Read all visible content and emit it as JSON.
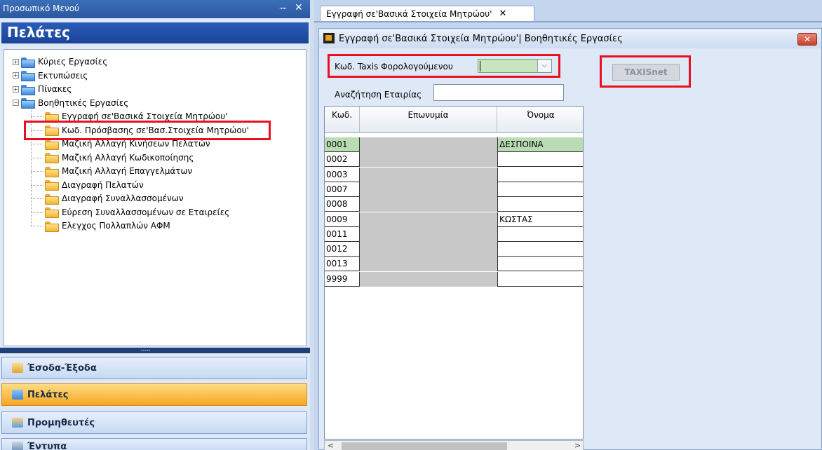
{
  "left_menu": {
    "title": "Προσωπικό Μενού",
    "pin_glyph": "2",
    "close_glyph": "✕",
    "section_title": "Πελάτες",
    "tree": [
      {
        "label": "Κύριες Εργασίες",
        "level": 0,
        "expander": "+"
      },
      {
        "label": "Εκτυπώσεις",
        "level": 0,
        "expander": "+"
      },
      {
        "label": "Πίνακες",
        "level": 0,
        "expander": "+"
      },
      {
        "label": "Βοηθητικές Εργασίες",
        "level": 0,
        "expander": "−"
      },
      {
        "label": "Εγγραφή σε'Βασικά Στοιχεία Μητρώου'",
        "level": 1
      },
      {
        "label": "Κωδ. Πρόσβασης σε'Βασ.Στοιχεία Μητρώου'",
        "level": 1
      },
      {
        "label": "Μαζική Αλλαγή Κινήσεων Πελατών",
        "level": 1
      },
      {
        "label": "Μαζική Αλλαγή Κωδικοποίησης",
        "level": 1
      },
      {
        "label": "Μαζική Αλλαγή Επαγγελμάτων",
        "level": 1
      },
      {
        "label": "Διαγραφή Πελατών",
        "level": 1
      },
      {
        "label": "Διαγραφή Συναλλασσομένων",
        "level": 1
      },
      {
        "label": "Εύρεση Συναλλασσομένων σε Εταιρείες",
        "level": 1
      },
      {
        "label": "Ελεγχος Πολλαπλών ΑΦΜ",
        "level": 1
      }
    ],
    "nav_buttons": [
      {
        "label": "Έσοδα-Έξοδα",
        "active": false
      },
      {
        "label": "Πελάτες",
        "active": true
      },
      {
        "label": "Προμηθευτές",
        "active": false
      },
      {
        "label": "Έντυπα",
        "active": false
      }
    ],
    "splitter_grip": "·········"
  },
  "document": {
    "tab_label": "Εγγραφή σε'Βασικά Στοιχεία Μητρώου'",
    "tab_close": "✕",
    "form_title": "Εγγραφή σε'Βασικά Στοιχεία Μητρώου'| Βοηθητικές Εργασίες",
    "close_glyph": "✕",
    "taxis_label": "Κωδ. Taxis Φορολογούμενου",
    "taxis_value": "",
    "dropdown_glyph": "⌵",
    "taxisnet_button": "TAXISnet",
    "search_label": "Αναζήτηση Εταιρίας",
    "search_value": ""
  },
  "grid": {
    "columns": [
      "Κωδ.",
      "Επωνυμία",
      "Όνομα"
    ],
    "rows": [
      {
        "code": "0001",
        "name": "",
        "first": "ΔΕΣΠΟΙΝΑ",
        "selected": true
      },
      {
        "code": "0002",
        "name": "",
        "first": "",
        "selected": false
      },
      {
        "code": "0003",
        "name": "",
        "first": "",
        "selected": false
      },
      {
        "code": "0007",
        "name": "",
        "first": "",
        "selected": false
      },
      {
        "code": "0008",
        "name": "",
        "first": "",
        "selected": false
      },
      {
        "code": "0009",
        "name": "",
        "first": "ΚΩΣΤΑΣ",
        "selected": false
      },
      {
        "code": "0011",
        "name": "",
        "first": "",
        "selected": false
      },
      {
        "code": "0012",
        "name": "",
        "first": "",
        "selected": false
      },
      {
        "code": "0013",
        "name": "",
        "first": "",
        "selected": false
      },
      {
        "code": "9999",
        "name": "",
        "first": "",
        "selected": false
      }
    ],
    "scroll_left": "<",
    "scroll_right": ">"
  },
  "colors": {
    "highlight_box": "#e8101e",
    "active_nav": "#f6a623",
    "selected_row": "#b9dcb4"
  }
}
